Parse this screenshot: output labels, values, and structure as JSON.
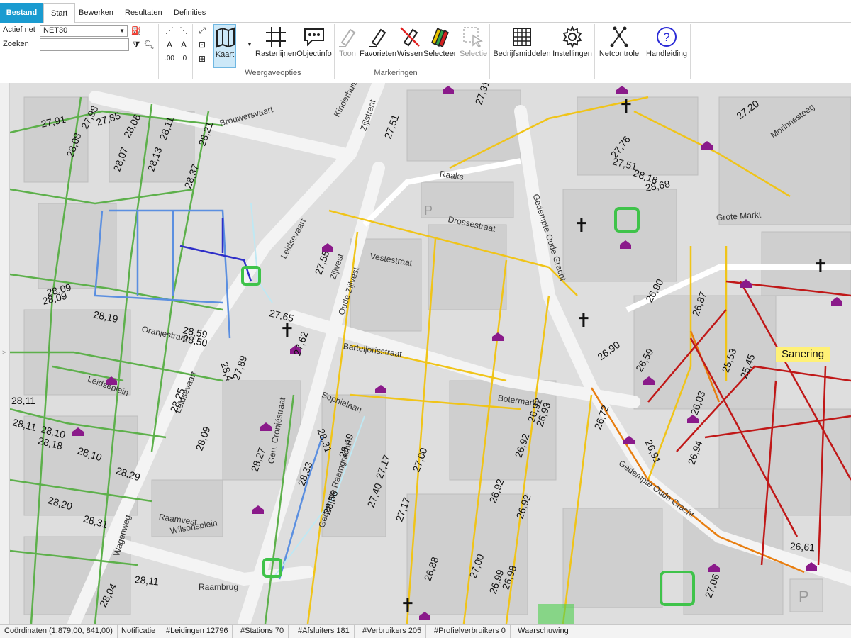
{
  "tabs": [
    {
      "label": "Bestand"
    },
    {
      "label": "Start"
    },
    {
      "label": "Bewerken"
    },
    {
      "label": "Resultaten"
    },
    {
      "label": "Definities"
    }
  ],
  "ribbon": {
    "actief_net_label": "Actief net",
    "actief_net_value": "NET30",
    "zoeken_label": "Zoeken",
    "zoeken_value": "",
    "buttons": {
      "kaart": "Kaart",
      "rasterlijnen": "Rasterlijnen",
      "objectinfo": "Objectinfo",
      "toon": "Toon",
      "favorieten": "Favorieten",
      "wissen": "Wissen",
      "selecteer": "Selecteer",
      "selectie": "Selectie",
      "bedrijfsmiddelen": "Bedrijfsmiddelen",
      "instellingen": "Instellingen",
      "netcontrole": "Netcontrole",
      "handleiding": "Handleiding"
    },
    "groups": {
      "weergaveopties": "Weergaveopties",
      "markeringen": "Markeringen"
    }
  },
  "map": {
    "badge": "Sanering",
    "streets": {
      "brouwersvaart": "Brouwersvaart",
      "raaks": "Raaks",
      "drossestraat": "Drossestraat",
      "vestestraat": "Vestestraat",
      "leidsevaart1": "Leidsevaart",
      "leidsevaart2": "Leidsevaart",
      "zijlvest": "Zijlvest",
      "oude_zijlvest": "Oude Zijlvest",
      "botermarkt": "Botermarkt",
      "grote_markt": "Grote Markt",
      "gedempte_oude_gracht": "Gedempte Oude Gracht",
      "raamvest": "Raamvest",
      "raambrug": "Raambrug",
      "zijlstraat": "Zijlstraat",
      "morinnesteeg": "Morinnesteeg",
      "wilsonsplein": "Wilsonsplein",
      "sophialaan": "Sophialaan",
      "gedempte_raamgracht": "Gedempte Raamgracht",
      "barteljorisstraat": "Barteljorisstraat",
      "kinderhuis": "Kinderhuis",
      "leidseplein": "Leidseplein",
      "oranjestraat": "Oranjestraat",
      "wagenweg": "Wagenweg",
      "gen_cronjestraat": "Gen. Cronjéstraat"
    },
    "labels": [
      "27,91",
      "27,98",
      "27,85",
      "28,06",
      "28,11",
      "28,21",
      "28,08",
      "28,07",
      "28,13",
      "28,37",
      "28,09",
      "28,09",
      "28,19",
      "28,59",
      "28,50",
      "27,65",
      "27,89",
      "28,4",
      "27,62",
      "27,55",
      "27,51",
      "27,31",
      "27,20",
      "27,76",
      "27,51",
      "28,18",
      "28,68",
      "26,90",
      "26,87",
      "26,90",
      "26,59",
      "25,53",
      "25,45",
      "26,03",
      "26,91",
      "26,94",
      "26,72",
      "26,92",
      "26,93",
      "26,92",
      "26,92",
      "26,92",
      "26,88",
      "27,00",
      "26,99",
      "26,98",
      "27,06",
      "26,61",
      "28,11",
      "28,11",
      "28,10",
      "28,18",
      "28,10",
      "28,29",
      "28,25",
      "28,09",
      "28,27",
      "28,33",
      "28,56",
      "28,49",
      "28,31",
      "27,17",
      "27,00",
      "27,40",
      "27,17",
      "28,20",
      "28,31",
      "28,11",
      "28,04"
    ]
  },
  "status": {
    "coords": "Coördinaten  (1.879,00, 841,00)",
    "notificatie": "Notificatie",
    "leidingen": "#Leidingen  12796",
    "stations": "#Stations  70",
    "afsluiters": "#Afsluiters  181",
    "verbruikers": "#Verbruikers  205",
    "profielverbruikers": "#Profielverbruikers  0",
    "waarschuwing": "Waarschuwing"
  }
}
